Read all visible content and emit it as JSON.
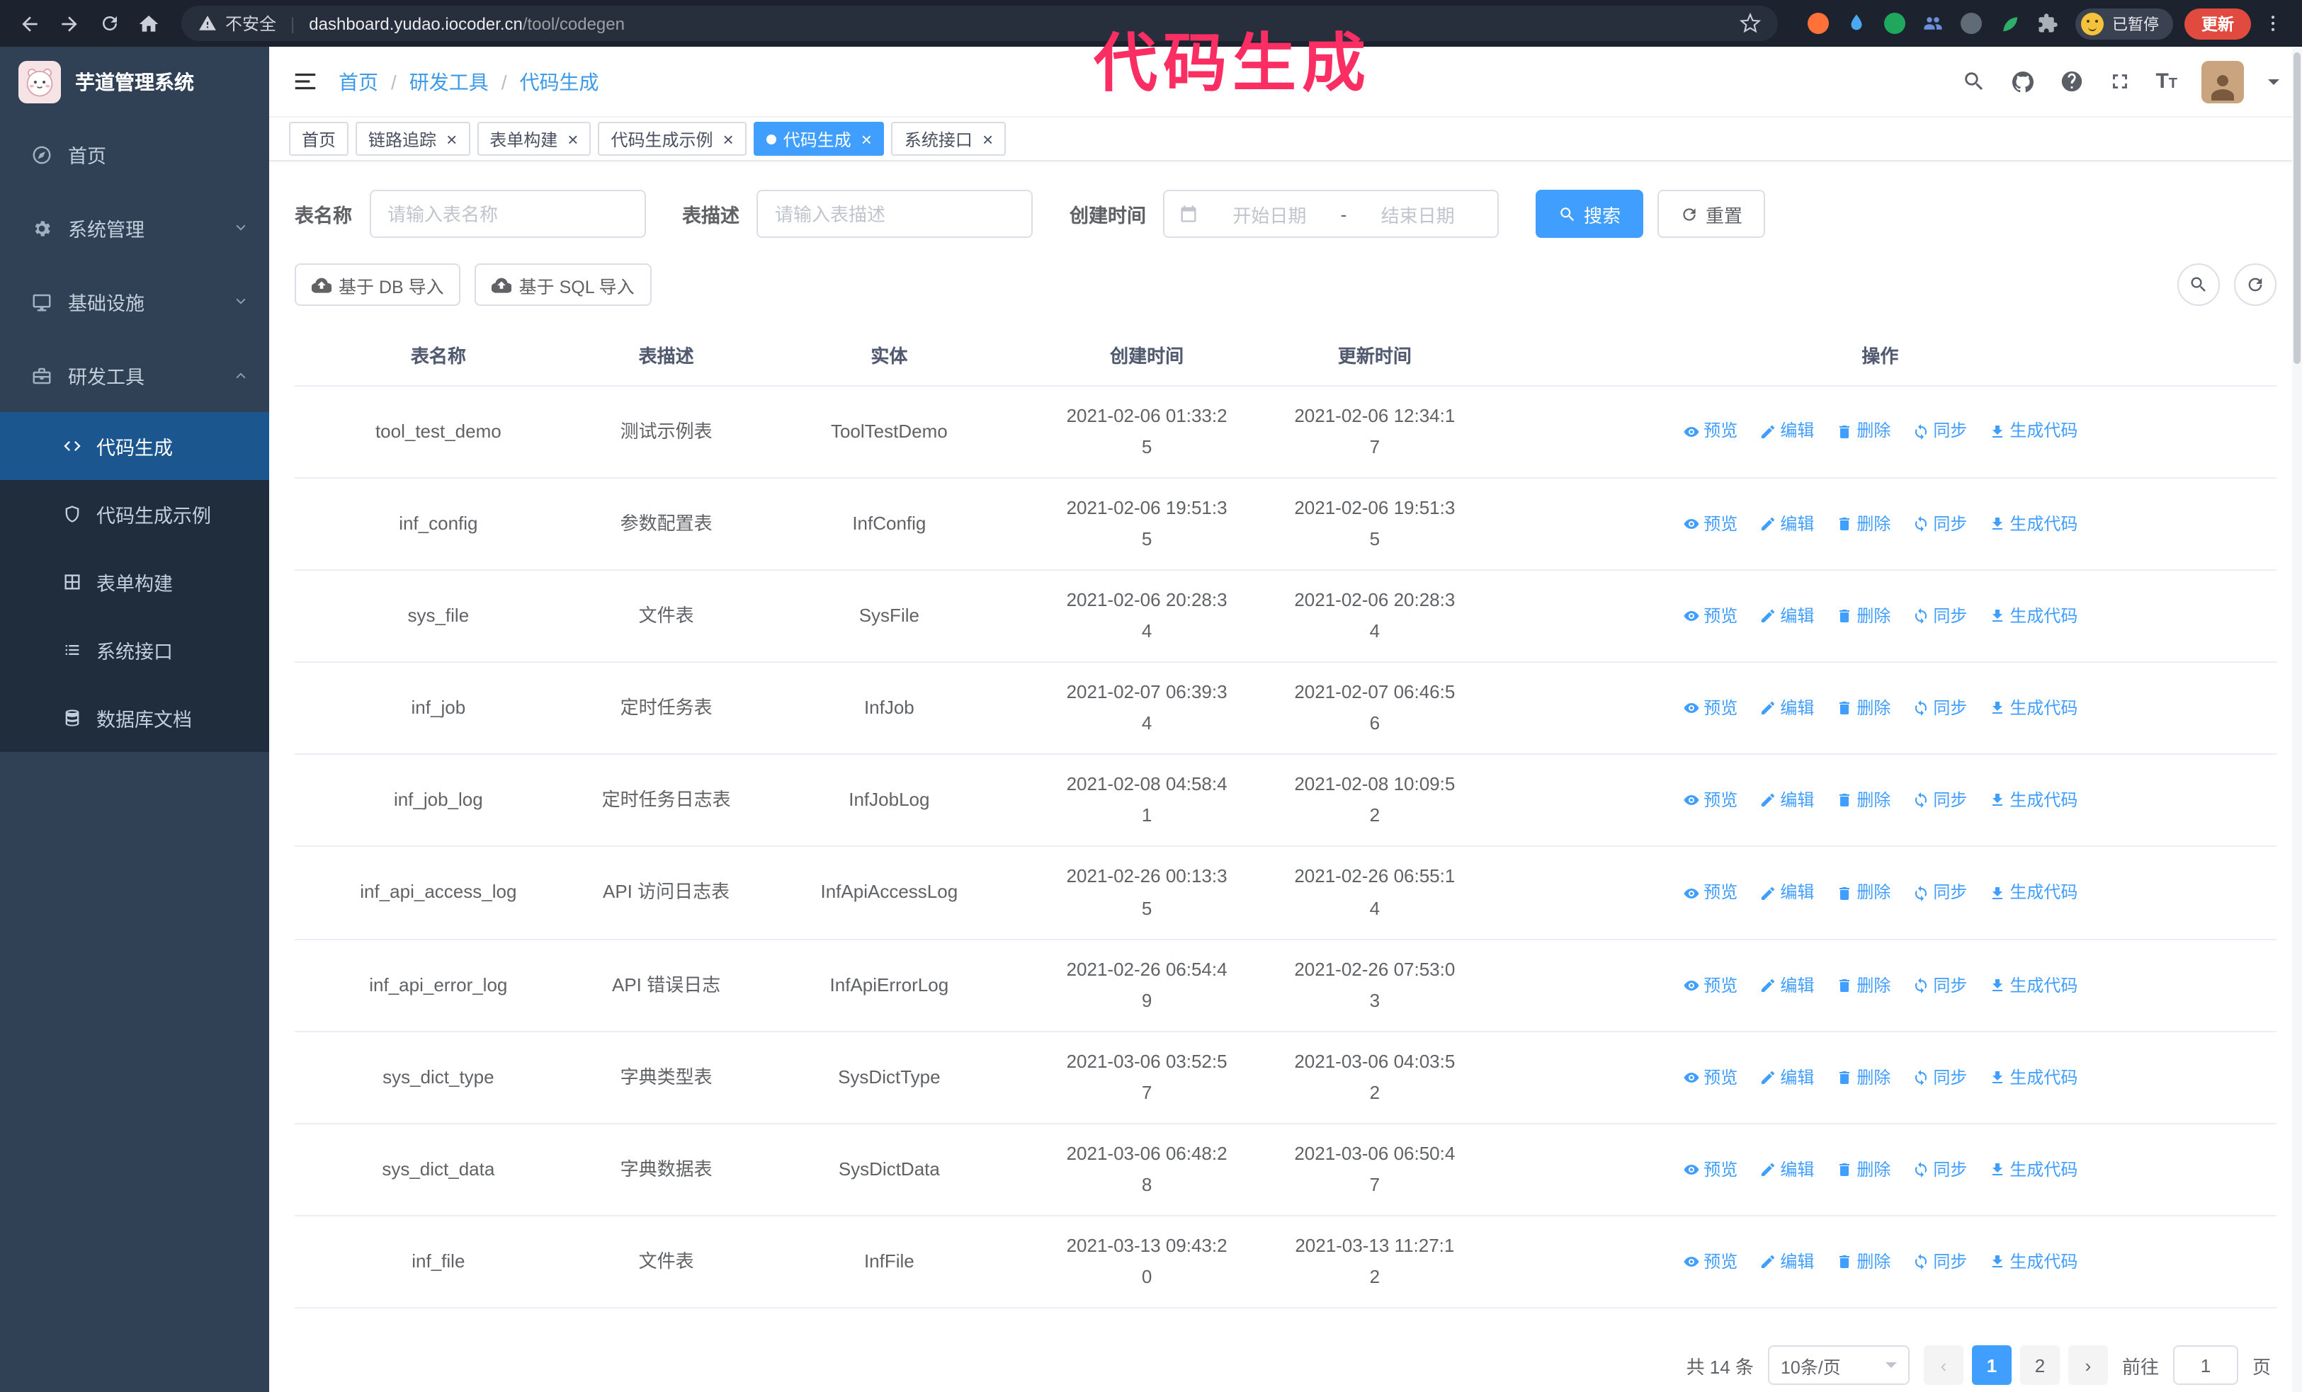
{
  "colors": {
    "accent": "#409eff",
    "link": "#409eff",
    "sidebar_bg": "#304156",
    "submenu_bg": "#1f2d3d",
    "sidebar_active_bg": "rgba(24,144,255,0.42)",
    "chrome_bg": "#1d232e",
    "annotation": "#fb2e63",
    "update_button": "#e04a3f"
  },
  "browser": {
    "security_label": "不安全",
    "url_host": "dashboard.yudao.iocoder.cn",
    "url_path": "/tool/codegen",
    "paused_badge": "已暂停",
    "update_button": "更新",
    "extensions": [
      {
        "name": "firefox-extension-icon",
        "type": "disc",
        "color": "#ff7139"
      },
      {
        "name": "droplet-extension-icon",
        "type": "svg",
        "icon": "droplet",
        "color": "#4aa8f0"
      },
      {
        "name": "green-extension-icon",
        "type": "disc",
        "color": "#1fa75d"
      },
      {
        "name": "contacts-extension-icon",
        "type": "svg",
        "icon": "people",
        "color": "#6b8fd9"
      },
      {
        "name": "translate-extension-icon",
        "type": "disc",
        "color": "#5f6b76"
      },
      {
        "name": "leaf-extension-icon",
        "type": "svg",
        "icon": "leaf",
        "color": "#2fae68"
      },
      {
        "name": "puzzle-extension-icon",
        "type": "svg",
        "icon": "puzzle",
        "color": "#aab0b8"
      }
    ]
  },
  "annotation": {
    "text": "代码生成"
  },
  "sidebar": {
    "logo_title": "芋道管理系统",
    "items": [
      {
        "key": "home",
        "label": "首页",
        "icon": "compass"
      },
      {
        "key": "system",
        "label": "系统管理",
        "icon": "gear",
        "chevron": "down"
      },
      {
        "key": "infra",
        "label": "基础设施",
        "icon": "monitor",
        "chevron": "down"
      },
      {
        "key": "devtools",
        "label": "研发工具",
        "icon": "toolbox",
        "chevron": "up",
        "expanded": true
      }
    ],
    "subitems": [
      {
        "key": "codegen",
        "label": "代码生成",
        "icon": "code",
        "active": true
      },
      {
        "key": "codegen-example",
        "label": "代码生成示例",
        "icon": "shield"
      },
      {
        "key": "form-builder",
        "label": "表单构建",
        "icon": "form"
      },
      {
        "key": "api",
        "label": "系统接口",
        "icon": "api"
      },
      {
        "key": "db-doc",
        "label": "数据库文档",
        "icon": "database"
      }
    ]
  },
  "header": {
    "breadcrumb": [
      "首页",
      "研发工具",
      "代码生成"
    ]
  },
  "tabs": [
    {
      "key": "home",
      "label": "首页",
      "closable": false,
      "active": false
    },
    {
      "key": "tracing",
      "label": "链路追踪",
      "closable": true,
      "active": false
    },
    {
      "key": "form-builder",
      "label": "表单构建",
      "closable": true,
      "active": false
    },
    {
      "key": "codegen-example",
      "label": "代码生成示例",
      "closable": true,
      "active": false
    },
    {
      "key": "codegen",
      "label": "代码生成",
      "closable": true,
      "active": true
    },
    {
      "key": "api",
      "label": "系统接口",
      "closable": true,
      "active": false
    }
  ],
  "filters": {
    "table_name_label": "表名称",
    "table_name_placeholder": "请输入表名称",
    "table_desc_label": "表描述",
    "table_desc_placeholder": "请输入表描述",
    "create_time_label": "创建时间",
    "date_start_placeholder": "开始日期",
    "date_separator": "-",
    "date_end_placeholder": "结束日期",
    "search_button": "搜索",
    "reset_button": "重置"
  },
  "toolbar": {
    "import_db": "基于 DB 导入",
    "import_sql": "基于 SQL 导入"
  },
  "table": {
    "columns": [
      "表名称",
      "表描述",
      "实体",
      "创建时间",
      "更新时间",
      "操作"
    ],
    "row_actions": [
      {
        "key": "preview",
        "label": "预览"
      },
      {
        "key": "edit",
        "label": "编辑"
      },
      {
        "key": "delete",
        "label": "删除"
      },
      {
        "key": "sync",
        "label": "同步"
      },
      {
        "key": "generate",
        "label": "生成代码"
      }
    ],
    "rows": [
      {
        "name": "tool_test_demo",
        "desc": "测试示例表",
        "entity": "ToolTestDemo",
        "created": "2021-02-06 01:33:25",
        "updated": "2021-02-06 12:34:17"
      },
      {
        "name": "inf_config",
        "desc": "参数配置表",
        "entity": "InfConfig",
        "created": "2021-02-06 19:51:35",
        "updated": "2021-02-06 19:51:35"
      },
      {
        "name": "sys_file",
        "desc": "文件表",
        "entity": "SysFile",
        "created": "2021-02-06 20:28:34",
        "updated": "2021-02-06 20:28:34"
      },
      {
        "name": "inf_job",
        "desc": "定时任务表",
        "entity": "InfJob",
        "created": "2021-02-07 06:39:34",
        "updated": "2021-02-07 06:46:56"
      },
      {
        "name": "inf_job_log",
        "desc": "定时任务日志表",
        "entity": "InfJobLog",
        "created": "2021-02-08 04:58:41",
        "updated": "2021-02-08 10:09:52"
      },
      {
        "name": "inf_api_access_log",
        "desc": "API 访问日志表",
        "entity": "InfApiAccessLog",
        "created": "2021-02-26 00:13:35",
        "updated": "2021-02-26 06:55:14"
      },
      {
        "name": "inf_api_error_log",
        "desc": "API 错误日志",
        "entity": "InfApiErrorLog",
        "created": "2021-02-26 06:54:49",
        "updated": "2021-02-26 07:53:03"
      },
      {
        "name": "sys_dict_type",
        "desc": "字典类型表",
        "entity": "SysDictType",
        "created": "2021-03-06 03:52:57",
        "updated": "2021-03-06 04:03:52"
      },
      {
        "name": "sys_dict_data",
        "desc": "字典数据表",
        "entity": "SysDictData",
        "created": "2021-03-06 06:48:28",
        "updated": "2021-03-06 06:50:47"
      },
      {
        "name": "inf_file",
        "desc": "文件表",
        "entity": "InfFile",
        "created": "2021-03-13 09:43:20",
        "updated": "2021-03-13 11:27:12"
      }
    ]
  },
  "pagination": {
    "total": "共 14 条",
    "page_size": "10条/页",
    "pages": [
      "1",
      "2"
    ],
    "active_page": "1",
    "goto_label": "前往",
    "goto_value": "1",
    "goto_suffix": "页"
  }
}
